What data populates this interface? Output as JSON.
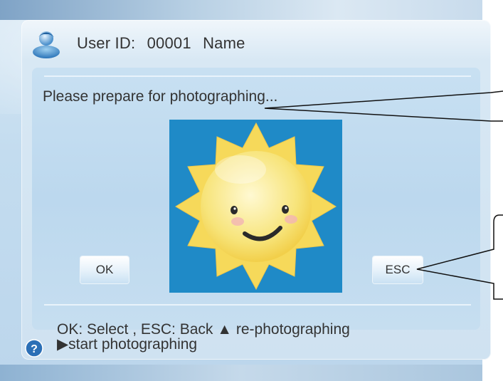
{
  "header": {
    "user_id_label": "User ID:",
    "user_id_value": "00001",
    "name_label": "Name"
  },
  "main": {
    "prompt": "Please prepare for photographing...",
    "ok_label": "OK",
    "esc_label": "ESC"
  },
  "footer": {
    "line1": "OK: Select , ESC: Back ▲ re-photographing",
    "line2": "▶start photographing"
  },
  "icons": {
    "user": "user-avatar-icon",
    "help": "question-mark-icon",
    "photo": "smiling-sun-image"
  },
  "colors": {
    "photo_background": "#1f8ac7",
    "sun_fill": "#f7e27a",
    "help_icon": "#2b6fb6"
  }
}
